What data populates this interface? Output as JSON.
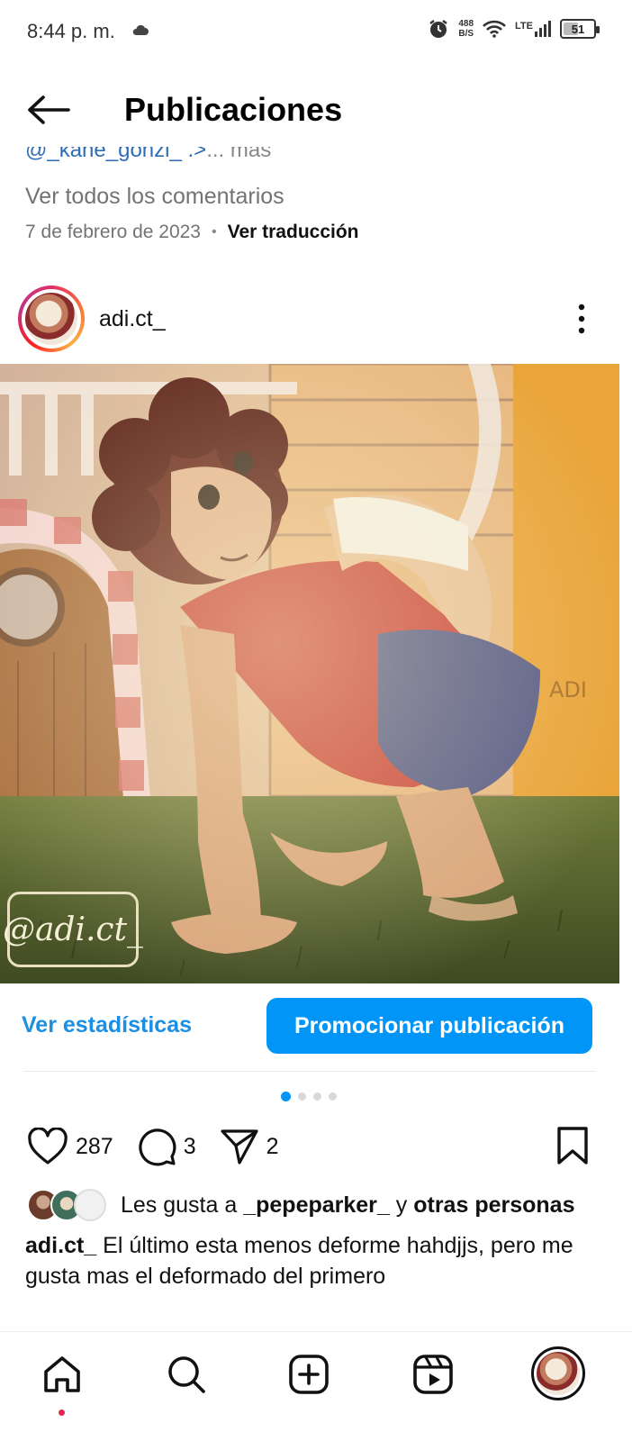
{
  "status_bar": {
    "time": "8:44 p. m.",
    "net_speed_value": "488",
    "net_speed_unit": "B/S",
    "network_type": "LTE",
    "battery_level": "51",
    "icons": [
      "cloud-icon",
      "alarm-icon",
      "wifi-icon",
      "signal-icon",
      "battery-icon"
    ]
  },
  "header": {
    "title": "Publicaciones",
    "back_icon": "arrow-left-icon"
  },
  "previous_post": {
    "caption_fragment": "@_kane_gonzi_ .>",
    "more_label": "... más",
    "view_comments": "Ver todos los comentarios",
    "date": "7 de febrero de 2023",
    "translate_label": "Ver traducción"
  },
  "post": {
    "username": "adi.ct_",
    "image_watermark": "@adi.ct_",
    "stats_label": "Ver estadísticas",
    "promote_label": "Promocionar publicación",
    "carousel_total": 4,
    "carousel_active": 1,
    "likes_count": "287",
    "comments_count": "3",
    "shares_count": "2",
    "likes_prefix": "Les gusta a ",
    "likes_user": "_pepeparker_",
    "likes_middle": " y ",
    "likes_others": "otras personas",
    "caption_user": "adi.ct_",
    "caption_text": " El último esta menos deforme hahdjjs, pero me gusta mas el deformado del primero"
  },
  "bottom_nav": {
    "items": [
      "home-icon",
      "search-icon",
      "create-icon",
      "reels-icon",
      "profile-avatar"
    ]
  },
  "colors": {
    "accent_blue": "#0095f6",
    "link_blue": "#1a8fe3",
    "notification_red": "#e3264c"
  }
}
